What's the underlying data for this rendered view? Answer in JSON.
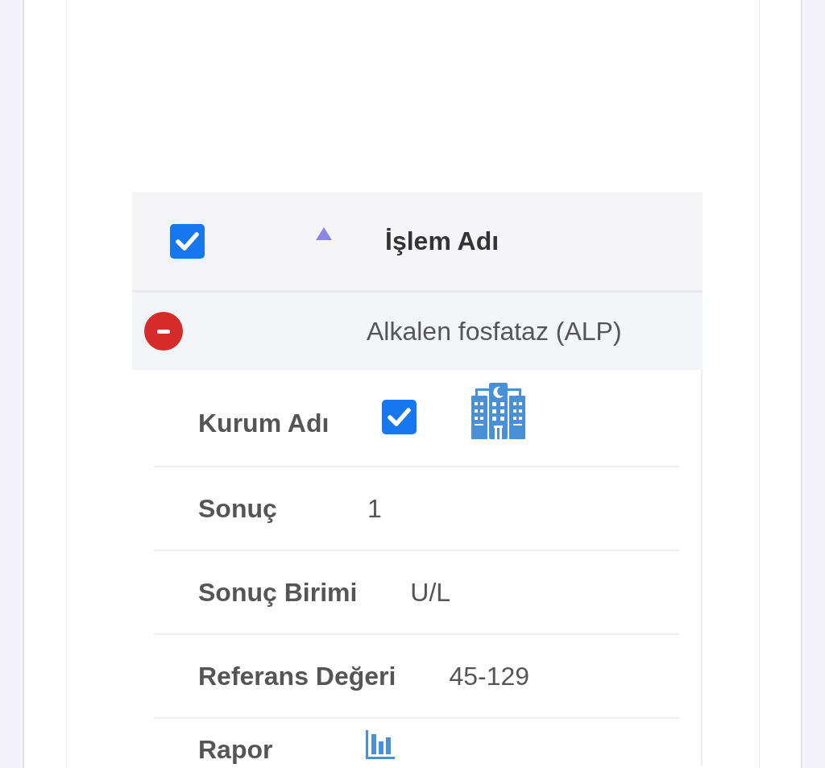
{
  "table": {
    "select_all_checked": true,
    "sort_ascending": true,
    "columns": [
      {
        "label": "İşlem Adı"
      }
    ],
    "rows": [
      {
        "name": "Alkalen fosfataz (ALP)",
        "expanded": true,
        "details": [
          {
            "kind": "institution",
            "label": "Kurum Adı",
            "checked": true
          },
          {
            "kind": "text",
            "label": "Sonuç",
            "value": "1"
          },
          {
            "kind": "text",
            "label": "Sonuç Birimi",
            "value": "U/L"
          },
          {
            "kind": "text",
            "label": "Referans Değeri",
            "value": "45-129"
          },
          {
            "kind": "report",
            "label": "Rapor"
          }
        ]
      }
    ]
  }
}
